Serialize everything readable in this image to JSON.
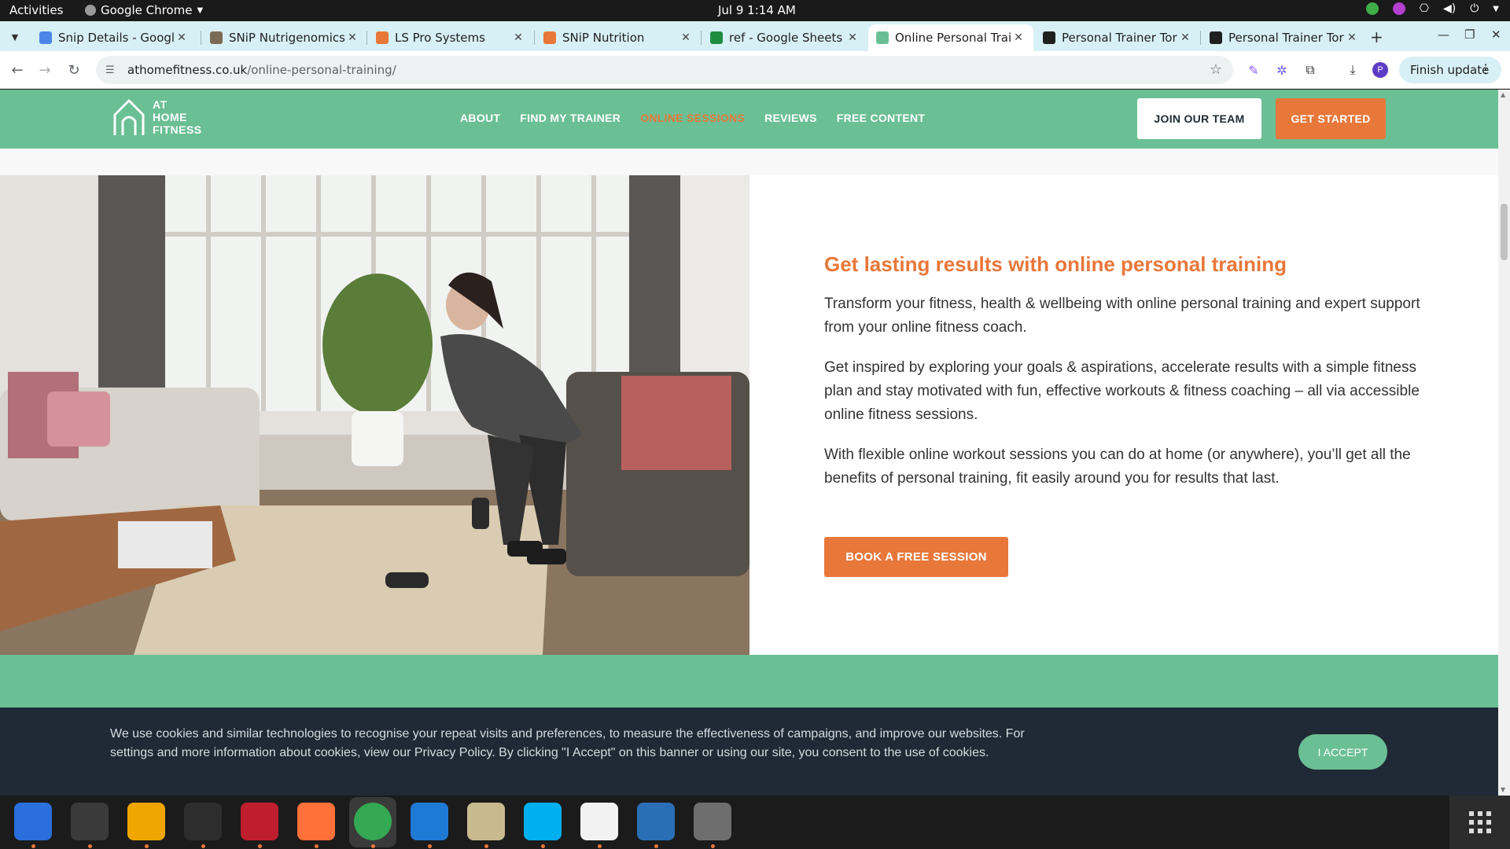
{
  "system": {
    "activities": "Activities",
    "app_name": "Google Chrome",
    "clock": "Jul 9  1:14 AM"
  },
  "tabs": [
    {
      "title": "Snip Details - Google",
      "favicon_color": "#4a86e8"
    },
    {
      "title": "SNiP Nutrigenomics",
      "favicon_color": "#7b6a55"
    },
    {
      "title": "LS Pro Systems",
      "favicon_color": "#e8773a"
    },
    {
      "title": "SNiP Nutrition",
      "favicon_color": "#e8773a"
    },
    {
      "title": "ref - Google Sheets",
      "favicon_color": "#1e8e3e"
    },
    {
      "title": "Online Personal Trai",
      "favicon_color": "#6bbf94",
      "active": true
    },
    {
      "title": "Personal Trainer Tor",
      "favicon_color": "#1f1f1f"
    },
    {
      "title": "Personal Trainer Tor",
      "favicon_color": "#1f1f1f"
    }
  ],
  "toolbar": {
    "url_host": "athomefitness.co.uk",
    "url_path": "/online-personal-training/",
    "finish_update": "Finish update",
    "profile_initial": "P"
  },
  "site": {
    "logo_lines": [
      "AT",
      "HOME",
      "FITNESS"
    ],
    "nav": [
      "ABOUT",
      "FIND MY TRAINER",
      "ONLINE SESSIONS",
      "REVIEWS",
      "FREE CONTENT"
    ],
    "nav_active_index": 2,
    "join_button": "JOIN OUR TEAM",
    "start_button": "GET STARTED"
  },
  "main": {
    "headline": "Get lasting results with online personal training",
    "paragraphs": [
      "Transform your fitness, health & wellbeing with online personal training and expert support from your online fitness coach.",
      "Get inspired by exploring your goals & aspirations, accelerate results with a simple fitness plan and stay motivated with fun, effective workouts & fitness coaching – all via accessible online fitness sessions.",
      "With flexible online workout sessions you can do at home (or anywhere), you’ll get all the benefits of personal training, fit easily around you for results that last."
    ],
    "cta": "BOOK A FREE SESSION"
  },
  "cookie": {
    "text": "We use cookies and similar technologies to recognise your repeat visits and preferences, to measure the effectiveness of campaigns, and improve our websites. For settings and more information about cookies, view our Privacy Policy. By clicking \"I Accept\" on this banner or using our site, you consent to the use of cookies.",
    "accept": "I ACCEPT"
  },
  "colors": {
    "brand_green": "#6bbf94",
    "brand_orange": "#e8773a",
    "cookie_bg": "#1f2a36"
  },
  "dock": [
    {
      "name": "thunderbird-icon",
      "color": "#2a6fdb"
    },
    {
      "name": "terminal-icon",
      "color": "#3a3a3a"
    },
    {
      "name": "calculator-icon",
      "color": "#f0a500"
    },
    {
      "name": "system-monitor-icon",
      "color": "#2d2d2d"
    },
    {
      "name": "filezilla-icon",
      "color": "#bf1e2e"
    },
    {
      "name": "firefox-icon",
      "color": "#ff7139"
    },
    {
      "name": "chrome-icon",
      "color": "#34a853"
    },
    {
      "name": "vscode-icon",
      "color": "#1f7ad6"
    },
    {
      "name": "files-icon",
      "color": "#c9b98f"
    },
    {
      "name": "skype-icon",
      "color": "#00aff0"
    },
    {
      "name": "text-editor-icon",
      "color": "#f2f2f2"
    },
    {
      "name": "libreoffice-writer-icon",
      "color": "#2a6fb5"
    },
    {
      "name": "disk-utility-icon",
      "color": "#6e6e6e"
    }
  ]
}
